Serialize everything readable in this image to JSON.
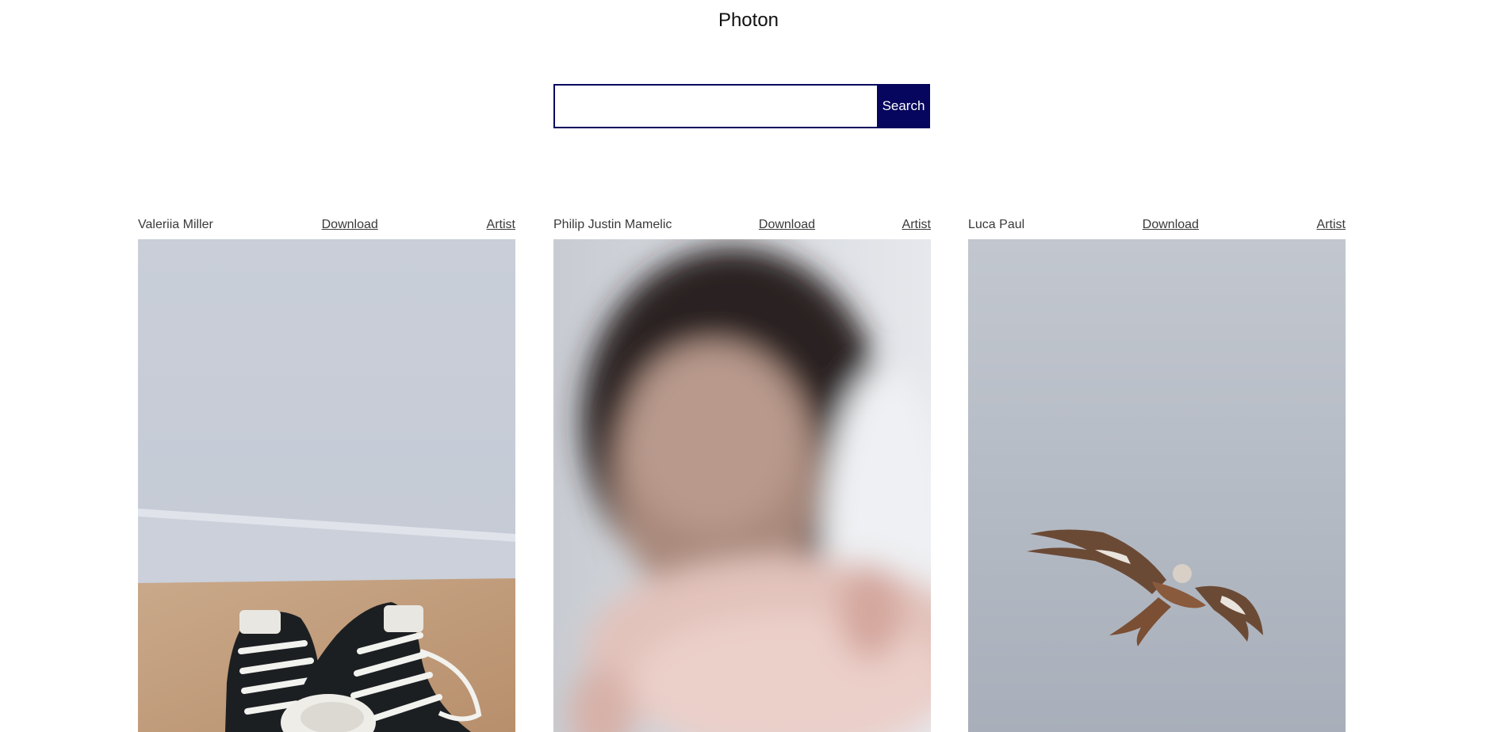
{
  "app": {
    "title": "Photon"
  },
  "search": {
    "placeholder": "",
    "value": "",
    "button_label": "Search"
  },
  "photos": [
    {
      "artist_name": "Valeriia Miller",
      "download_label": "Download",
      "artist_link_label": "Artist",
      "subject": "black high-top sneakers on wooden floor"
    },
    {
      "artist_name": "Philip Justin Mamelic",
      "download_label": "Download",
      "artist_link_label": "Artist",
      "subject": "blurred person reaching hand toward camera"
    },
    {
      "artist_name": "Luca Paul",
      "download_label": "Download",
      "artist_link_label": "Artist",
      "subject": "bird of prey flying in grey sky"
    }
  ],
  "colors": {
    "accent": "#06065e",
    "text": "#3a3a3a",
    "background": "#ffffff"
  }
}
